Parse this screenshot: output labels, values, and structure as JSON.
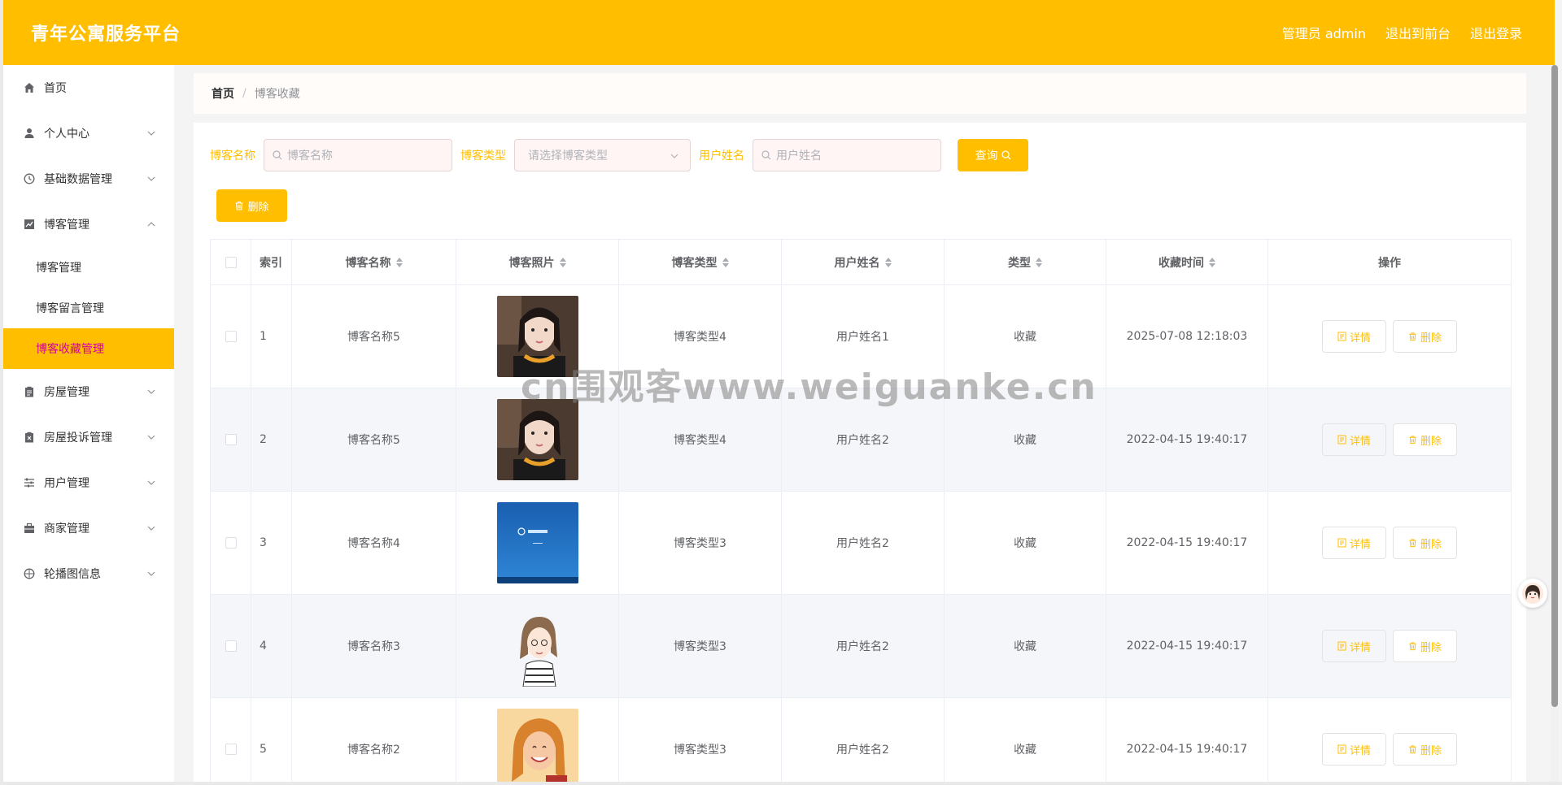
{
  "header": {
    "title": "青年公寓服务平台",
    "admin_label": "管理员 admin",
    "to_front": "退出到前台",
    "logout": "退出登录"
  },
  "sidebar": {
    "items": [
      {
        "label": "首页",
        "icon": "home-icon"
      },
      {
        "label": "个人中心",
        "icon": "user-icon"
      },
      {
        "label": "基础数据管理",
        "icon": "clock-icon"
      },
      {
        "label": "博客管理",
        "icon": "chart-icon"
      },
      {
        "label": "房屋管理",
        "icon": "clipboard-icon"
      },
      {
        "label": "房屋投诉管理",
        "icon": "clipboard-x-icon"
      },
      {
        "label": "用户管理",
        "icon": "sliders-icon"
      },
      {
        "label": "商家管理",
        "icon": "briefcase-icon"
      },
      {
        "label": "轮播图信息",
        "icon": "aperture-icon"
      }
    ],
    "blog_sub": [
      {
        "label": "博客管理"
      },
      {
        "label": "博客留言管理"
      },
      {
        "label": "博客收藏管理"
      }
    ]
  },
  "breadcrumb": {
    "home": "首页",
    "separator": "/",
    "current": "博客收藏"
  },
  "search": {
    "name_label": "博客名称",
    "name_placeholder": "博客名称",
    "type_label": "博客类型",
    "type_placeholder": "请选择博客类型",
    "user_label": "用户姓名",
    "user_placeholder": "用户姓名",
    "query_button": "查询"
  },
  "delete_button": "删除",
  "table": {
    "headers": [
      "索引",
      "博客名称",
      "博客照片",
      "博客类型",
      "用户姓名",
      "类型",
      "收藏时间",
      "操作"
    ],
    "rows": [
      {
        "index": "1",
        "name": "博客名称5",
        "photo": "photo-girl-selfie",
        "type": "博客类型4",
        "user": "用户姓名1",
        "kind": "收藏",
        "time": "2025-07-08 12:18:03"
      },
      {
        "index": "2",
        "name": "博客名称5",
        "photo": "photo-girl-selfie",
        "type": "博客类型4",
        "user": "用户姓名2",
        "kind": "收藏",
        "time": "2022-04-15 19:40:17"
      },
      {
        "index": "3",
        "name": "博客名称4",
        "photo": "photo-blue-screen",
        "type": "博客类型3",
        "user": "用户姓名2",
        "kind": "收藏",
        "time": "2022-04-15 19:40:17"
      },
      {
        "index": "4",
        "name": "博客名称3",
        "photo": "photo-cartoon-girl",
        "type": "博客类型3",
        "user": "用户姓名2",
        "kind": "收藏",
        "time": "2022-04-15 19:40:17"
      },
      {
        "index": "5",
        "name": "博客名称2",
        "photo": "photo-smiling-girl",
        "type": "博客类型3",
        "user": "用户姓名2",
        "kind": "收藏",
        "time": "2022-04-15 19:40:17"
      }
    ],
    "detail_button": "详情",
    "delete_button": "删除"
  },
  "watermark": "cn围观客www.weiguanke.cn",
  "colors": {
    "accent": "#ffbf00",
    "active_text": "#d500a0"
  }
}
